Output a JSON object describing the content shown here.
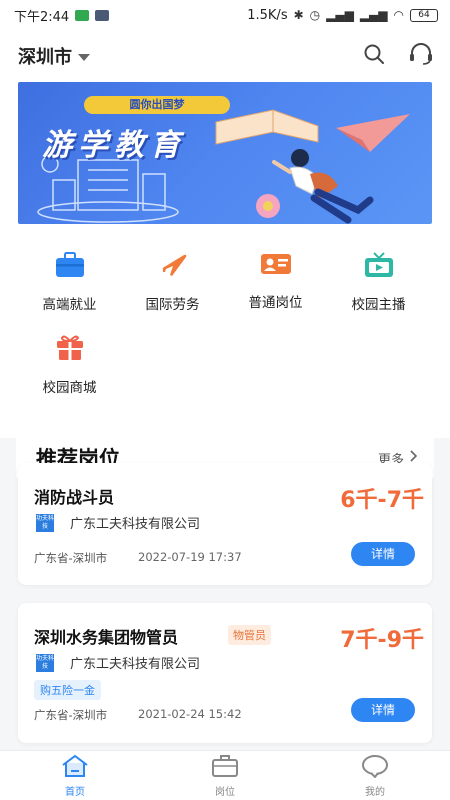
{
  "status_bar": {
    "time": "下午2:44",
    "speed": "1.5K/s",
    "battery": "64"
  },
  "header": {
    "city": "深圳市",
    "icons": [
      "search-icon",
      "headset-icon"
    ]
  },
  "banner": {
    "tag": "圆你出国梦",
    "title": "游学教育"
  },
  "menu": [
    {
      "label": "高端就业",
      "icon": "briefcase-icon",
      "color": "#2e86f2"
    },
    {
      "label": "国际劳务",
      "icon": "airplane-icon",
      "color": "#f27a38"
    },
    {
      "label": "普通岗位",
      "icon": "id-card-icon",
      "color": "#f27a38"
    },
    {
      "label": "校园主播",
      "icon": "tv-icon",
      "color": "#2fb7a5"
    },
    {
      "label": "校园商城",
      "icon": "gift-icon",
      "color": "#f0624a"
    }
  ],
  "section": {
    "title": "推荐岗位",
    "more": "更多"
  },
  "jobs": [
    {
      "title": "消防战斗员",
      "salary": "6千-7千",
      "logo_text": "功夫科技",
      "company": "广东工夫科技有限公司",
      "location": "广东省-深圳市",
      "time": "2022-07-19 17:37",
      "button": "详情"
    },
    {
      "title": "深圳水务集团物管员",
      "role_tag": "物管员",
      "salary": "7千-9千",
      "logo_text": "功夫科技",
      "company": "广东工夫科技有限公司",
      "benefit": "购五险一金",
      "location": "广东省-深圳市",
      "time": "2021-02-24 15:42",
      "button": "详情"
    }
  ],
  "tabbar": [
    {
      "label": "首页",
      "icon": "home-icon",
      "active": true
    },
    {
      "label": "岗位",
      "icon": "briefcase-icon",
      "active": false
    },
    {
      "label": "我的",
      "icon": "chat-bubble-icon",
      "active": false
    }
  ],
  "colors": {
    "accent": "#2e86f2",
    "salary": "#f06a3a",
    "banner": "#4f86f0"
  }
}
